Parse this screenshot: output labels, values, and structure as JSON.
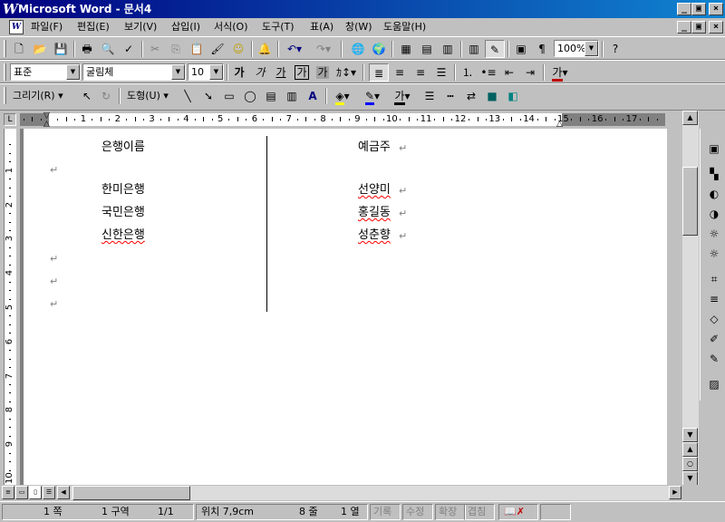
{
  "window": {
    "title": "Microsoft Word - 문서4",
    "app_icon_glyph": "W",
    "controls": {
      "minimize": "_",
      "maximize": "▣",
      "close": "×"
    }
  },
  "menu": {
    "items": [
      "파일(F)",
      "편집(E)",
      "보기(V)",
      "삽입(I)",
      "서식(O)",
      "도구(T)",
      "표(A)",
      "창(W)",
      "도움말(H)"
    ]
  },
  "toolbar_standard": {
    "zoom": "100%",
    "icons": [
      "new-doc-icon",
      "open-icon",
      "save-icon",
      "print-icon",
      "print-preview-icon",
      "spelling-icon",
      "cut-icon",
      "copy-icon",
      "paste-icon",
      "format-painter-icon",
      "smiley-icon",
      "bell-icon",
      "undo-icon",
      "redo-icon",
      "web-icon",
      "globe-icon",
      "table-icon",
      "insert-table-icon",
      "worksheet-icon",
      "columns-icon",
      "drawing-icon",
      "map-icon",
      "show-hide-icon",
      "help-icon"
    ]
  },
  "toolbar_format": {
    "style": "표준",
    "font": "굴림체",
    "size": "10",
    "bold_glyph": "가",
    "italic_glyph": "가",
    "underline_glyph": "가",
    "char_border_glyph": "가",
    "char_shade_glyph": "가",
    "font_color_glyph": "가"
  },
  "toolbar_draw": {
    "draw_label": "그리기(R)",
    "shapes_label": "도형(U)",
    "text_glyph": "가"
  },
  "ruler": {
    "corner": "L",
    "h_numbers": [
      "1",
      "2",
      "3",
      "4",
      "5",
      "6",
      "7",
      "8",
      "9",
      "10",
      "11",
      "12",
      "13",
      "14",
      "15",
      "16",
      "17"
    ],
    "v_numbers": [
      "1",
      "2",
      "3",
      "4",
      "5",
      "6",
      "7",
      "8",
      "9",
      "10"
    ]
  },
  "document": {
    "header_left": "은행이름",
    "header_right": "예금주",
    "rows": [
      {
        "bank": "한미은행",
        "owner": "선양미"
      },
      {
        "bank": "국민은행",
        "owner": "홍길동"
      },
      {
        "bank": "신한은행",
        "owner": "성춘향"
      }
    ],
    "para_mark": "↵"
  },
  "status": {
    "page": "1 쪽",
    "section": "1 구역",
    "page_of": "1/1",
    "position": "위치 7,9cm",
    "line": "8 줄",
    "col": "1 열",
    "rec": "기록",
    "trk": "수정",
    "ext": "확장",
    "ovr": "겹침"
  }
}
